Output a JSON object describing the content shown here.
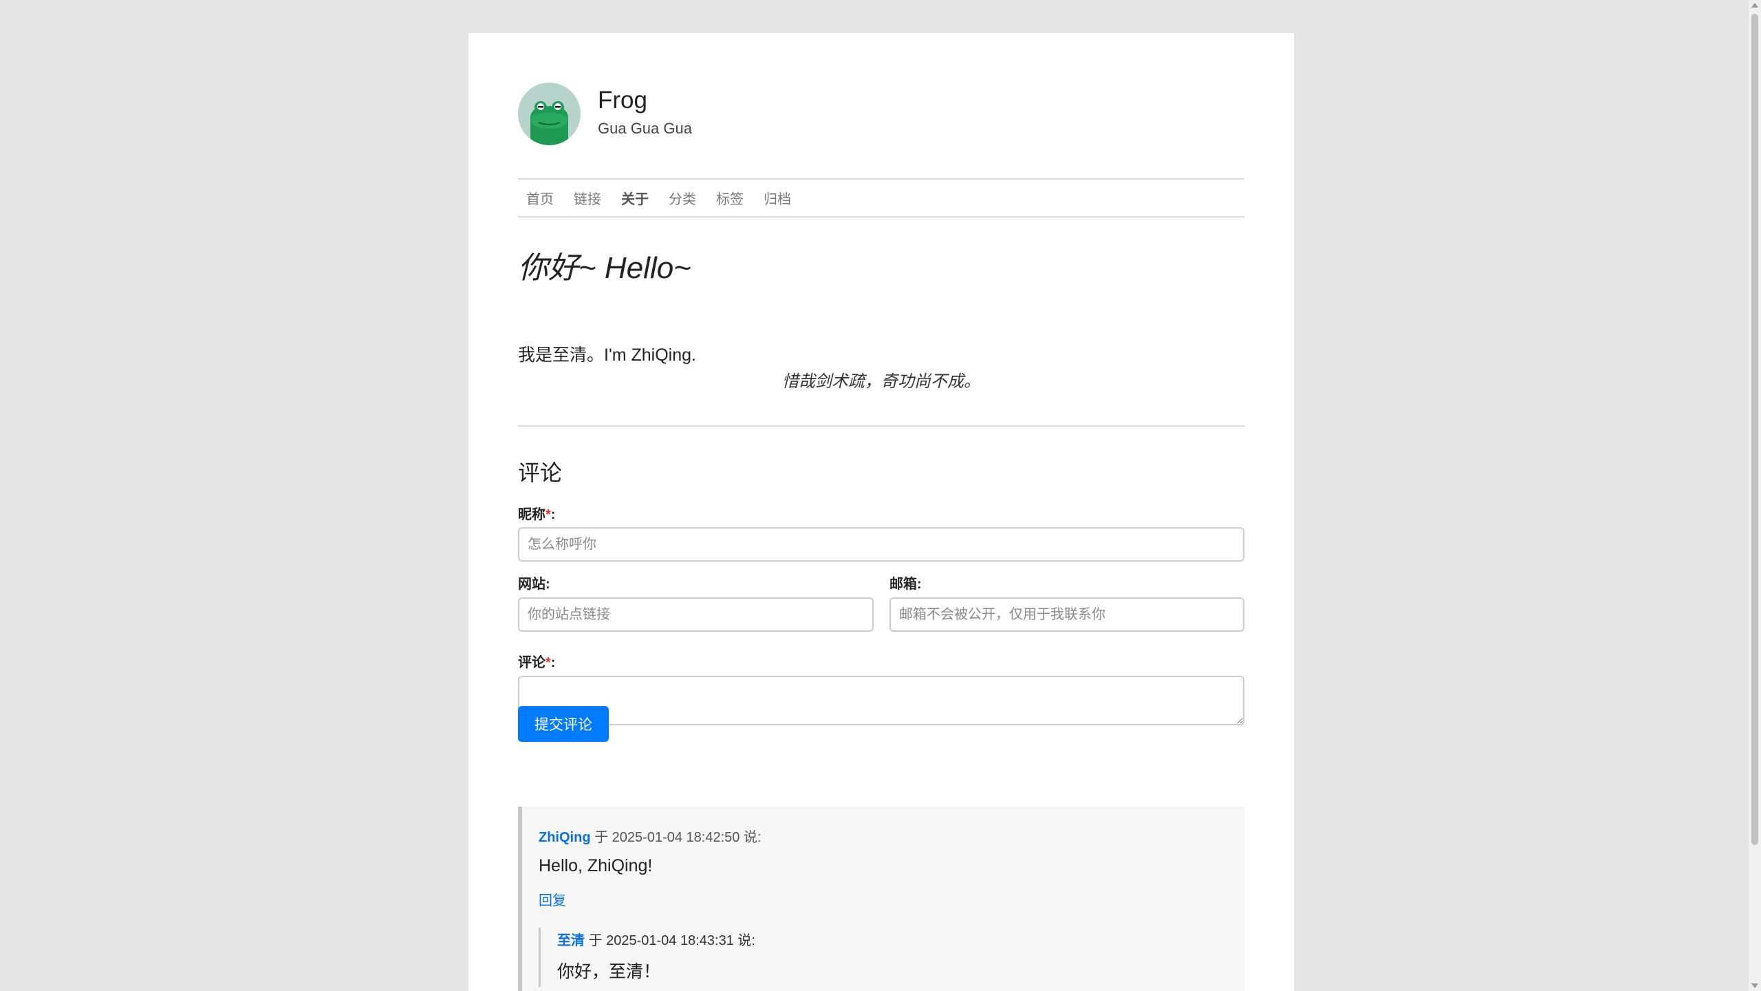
{
  "header": {
    "site_title": "Frog",
    "site_subtitle": "Gua Gua Gua",
    "avatar_icon": "frog-icon"
  },
  "nav": {
    "items": [
      {
        "label": "首页"
      },
      {
        "label": "链接"
      },
      {
        "label": "关于",
        "active": true
      },
      {
        "label": "分类"
      },
      {
        "label": "标签"
      },
      {
        "label": "归档"
      }
    ]
  },
  "post": {
    "title": "你好~ Hello~",
    "intro": "我是至清。I'm ZhiQing.",
    "quote": "惜哉剑术疏，奇功尚不成。"
  },
  "comment_form": {
    "heading": "评论",
    "nickname_label": "昵称",
    "nickname_placeholder": "怎么称呼你",
    "website_label": "网站",
    "website_placeholder": "你的站点链接",
    "email_label": "邮箱",
    "email_placeholder": "邮箱不会被公开，仅用于我联系你",
    "comment_label": "评论",
    "required_mark": "*",
    "colon": ":",
    "submit_label": "提交评论"
  },
  "comments": [
    {
      "author": "ZhiQing",
      "meta": "于 2025-01-04 18:42:50 说:",
      "body": "Hello, ZhiQing!",
      "reply_label": "回复",
      "replies": [
        {
          "author": "至清",
          "meta": "于 2025-01-04 18:43:31 说:",
          "body": "你好，至清！"
        }
      ]
    }
  ],
  "colors": {
    "accent": "#007bff",
    "link": "#0a70d6",
    "page_bg": "#e5e5e5",
    "required": "#dd3333"
  }
}
